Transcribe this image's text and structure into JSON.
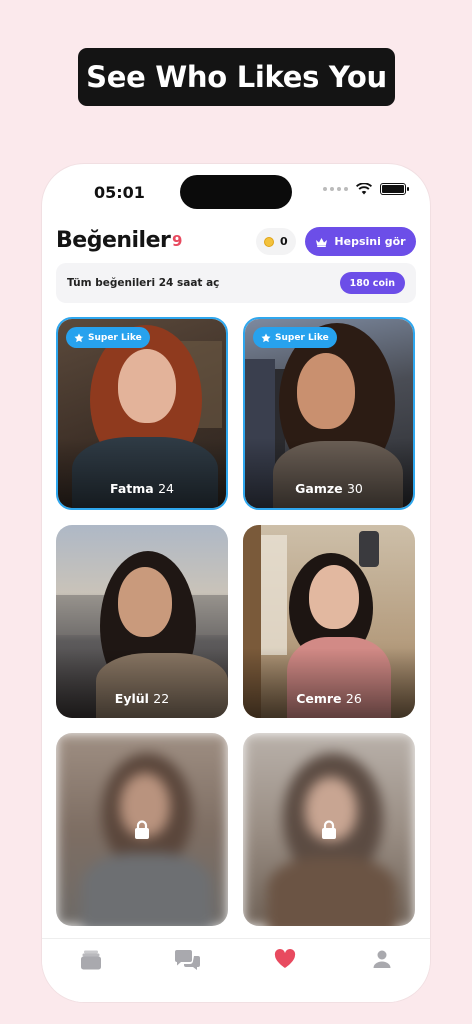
{
  "headline": "See Who Likes You",
  "status": {
    "time": "05:01"
  },
  "header": {
    "title": "Beğeniler",
    "count": "9",
    "coins": "0",
    "see_all_label": "Hepsini gör"
  },
  "banner": {
    "text": "Tüm beğenileri 24 saat aç",
    "button_label": "180 coin"
  },
  "badge_label": "Super Like",
  "cards": [
    {
      "name": "Fatma",
      "age": "24",
      "super_like": true
    },
    {
      "name": "Gamze",
      "age": "30",
      "super_like": true
    },
    {
      "name": "Eylül",
      "age": "22",
      "super_like": false
    },
    {
      "name": "Cemre",
      "age": "26",
      "super_like": false
    }
  ],
  "tabs": [
    "cards-icon",
    "chat-icon",
    "heart-icon",
    "profile-icon"
  ],
  "colors": {
    "accent": "#6c4ee8",
    "super_like": "#27a2ee",
    "like": "#e84a5f",
    "background": "#fbe9ec"
  }
}
